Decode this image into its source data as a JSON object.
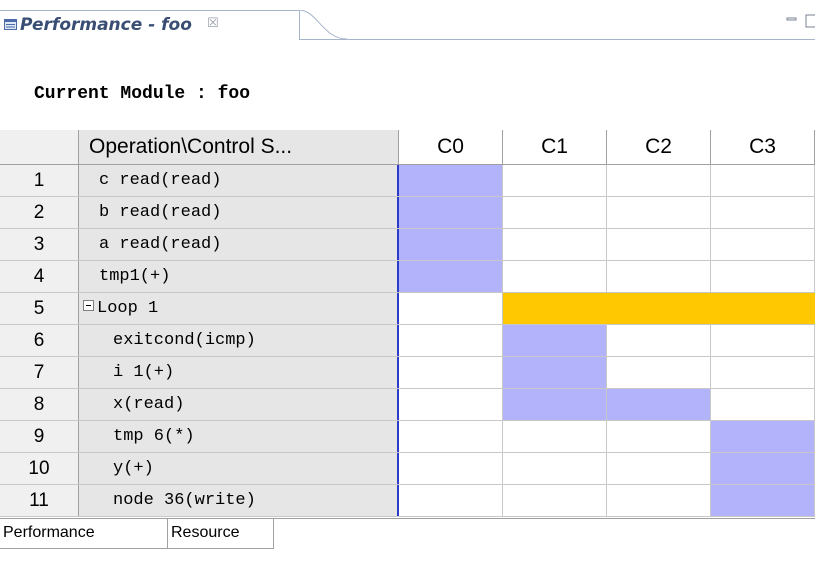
{
  "view": {
    "title": "Performance - foo",
    "close_glyph": "☒",
    "icon": "performance-view-icon"
  },
  "module": {
    "label": "Current Module : foo"
  },
  "table": {
    "corner": "",
    "op_header": "Operation\\Control S...",
    "columns": [
      "C0",
      "C1",
      "C2",
      "C3"
    ],
    "rows": [
      {
        "no": "1",
        "name": "c read(read)",
        "kind": "op",
        "active": [
          0
        ]
      },
      {
        "no": "2",
        "name": "b read(read)",
        "kind": "op",
        "active": [
          0
        ]
      },
      {
        "no": "3",
        "name": "a read(read)",
        "kind": "op",
        "active": [
          0
        ]
      },
      {
        "no": "4",
        "name": "tmp1(+)",
        "kind": "op",
        "active": [
          0
        ]
      },
      {
        "no": "5",
        "name": "Loop 1",
        "kind": "loop",
        "active": [
          1,
          2,
          3
        ]
      },
      {
        "no": "6",
        "name": "exitcond(icmp)",
        "kind": "nested",
        "active": [
          1
        ]
      },
      {
        "no": "7",
        "name": "i 1(+)",
        "kind": "nested",
        "active": [
          1
        ]
      },
      {
        "no": "8",
        "name": "x(read)",
        "kind": "nested",
        "active": [
          1,
          2
        ]
      },
      {
        "no": "9",
        "name": "tmp 6(*)",
        "kind": "nested",
        "active": [
          3
        ]
      },
      {
        "no": "10",
        "name": "y(+)",
        "kind": "nested",
        "active": [
          3
        ]
      },
      {
        "no": "11",
        "name": "node 36(write)",
        "kind": "nested",
        "active": [
          3
        ]
      }
    ]
  },
  "colors": {
    "active_cell": "#b3b3fb",
    "loop_bar": "#ffc800",
    "separator": "#2a3cc8"
  },
  "bottom_tabs": [
    {
      "label": "Performance",
      "selected": true
    },
    {
      "label": "Resource",
      "selected": false
    }
  ]
}
